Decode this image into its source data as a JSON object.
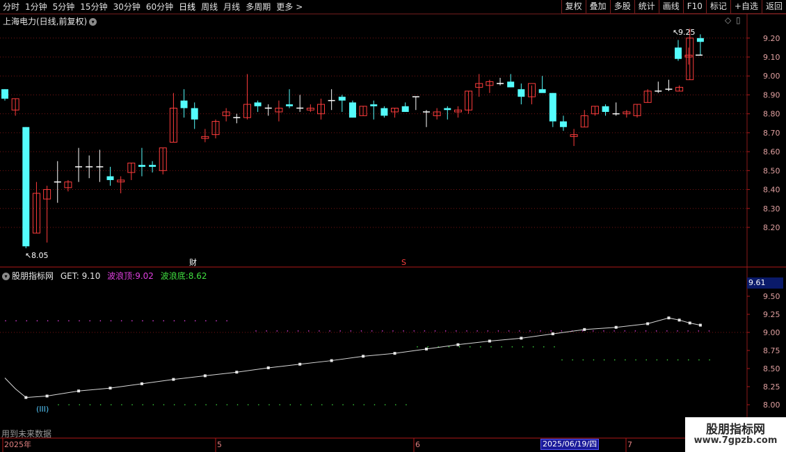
{
  "toolbar": {
    "left_items": [
      "分时",
      "1分钟",
      "5分钟",
      "15分钟",
      "30分钟",
      "60分钟",
      "日线",
      "周线",
      "月线",
      "多周期",
      "更多"
    ],
    "active": "日线",
    "more_arrow": ">",
    "right_buttons": [
      "复权",
      "叠加",
      "多股",
      "统计",
      "画线",
      "F10",
      "标记",
      "+自选",
      "返回"
    ]
  },
  "main_chart": {
    "title": "上海电力(日线,前复权)",
    "y_ticks": [
      "9.20",
      "9.10",
      "9.00",
      "8.90",
      "8.80",
      "8.70",
      "8.60",
      "8.50",
      "8.40",
      "8.30",
      "8.20"
    ],
    "high_label": "9.25",
    "low_label": "8.05",
    "marker_cai": "财",
    "marker_s": "S"
  },
  "sub_chart": {
    "title": "股朋指标网",
    "get_label": "GET:",
    "get_value": "9.10",
    "top_label": "波浪顶:",
    "top_value": "9.02",
    "bottom_label": "波浪底:",
    "bottom_value": "8.62",
    "value_box": "9.61",
    "y_ticks": [
      "9.50",
      "9.25",
      "9.00",
      "8.75",
      "8.50",
      "8.25",
      "8.00"
    ],
    "wave_label": "(III)",
    "future_note": "用到未来数据"
  },
  "time_axis": {
    "labels": [
      "2025年",
      "5",
      "6",
      "7"
    ],
    "selected_date": "2025/06/19/四"
  },
  "watermark": {
    "title": "股朋指标网",
    "url": "www.7gpzb.com"
  },
  "chart_data": {
    "type": "candlestick",
    "x": [
      1,
      2,
      3,
      4,
      5,
      6,
      7,
      8,
      9,
      10,
      11,
      12,
      13,
      14,
      15,
      16,
      17,
      18,
      19,
      20,
      21,
      22,
      23,
      24,
      25,
      26,
      27,
      28,
      29,
      30,
      31,
      32,
      33,
      34,
      35,
      36,
      37,
      38,
      39,
      40,
      41,
      42,
      43,
      44,
      45,
      46,
      47,
      48,
      49,
      50,
      51,
      52,
      53,
      54,
      55,
      56,
      57,
      58,
      59,
      60,
      61,
      62,
      63,
      64,
      65,
      66,
      67
    ],
    "ohlc": [
      [
        8.93,
        8.93,
        8.87,
        8.88
      ],
      [
        8.82,
        8.88,
        8.79,
        8.88
      ],
      [
        8.73,
        8.73,
        8.09,
        8.1
      ],
      [
        8.17,
        8.44,
        8.17,
        8.38
      ],
      [
        8.35,
        8.42,
        8.12,
        8.4
      ],
      [
        8.44,
        8.55,
        8.33,
        8.44
      ],
      [
        8.41,
        8.45,
        8.39,
        8.44
      ],
      [
        8.52,
        8.62,
        8.44,
        8.52
      ],
      [
        8.52,
        8.58,
        8.46,
        8.52
      ],
      [
        8.52,
        8.61,
        8.44,
        8.52
      ],
      [
        8.47,
        8.52,
        8.42,
        8.45
      ],
      [
        8.44,
        8.47,
        8.38,
        8.45
      ],
      [
        8.49,
        8.54,
        8.45,
        8.54
      ],
      [
        8.53,
        8.62,
        8.47,
        8.52
      ],
      [
        8.53,
        8.55,
        8.49,
        8.52
      ],
      [
        8.5,
        8.62,
        8.48,
        8.62
      ],
      [
        8.65,
        8.91,
        8.65,
        8.83
      ],
      [
        8.87,
        8.93,
        8.78,
        8.83
      ],
      [
        8.83,
        8.86,
        8.72,
        8.77
      ],
      [
        8.67,
        8.72,
        8.65,
        8.68
      ],
      [
        8.69,
        8.77,
        8.67,
        8.76
      ],
      [
        8.79,
        8.83,
        8.76,
        8.81
      ],
      [
        8.78,
        8.8,
        8.75,
        8.78
      ],
      [
        8.78,
        9.01,
        8.77,
        8.85
      ],
      [
        8.86,
        8.87,
        8.81,
        8.84
      ],
      [
        8.83,
        8.85,
        8.79,
        8.83
      ],
      [
        8.81,
        8.87,
        8.76,
        8.83
      ],
      [
        8.85,
        8.93,
        8.83,
        8.84
      ],
      [
        8.83,
        8.9,
        8.81,
        8.83
      ],
      [
        8.82,
        8.85,
        8.81,
        8.83
      ],
      [
        8.8,
        8.88,
        8.77,
        8.85
      ],
      [
        8.87,
        8.93,
        8.82,
        8.87
      ],
      [
        8.89,
        8.9,
        8.81,
        8.87
      ],
      [
        8.86,
        8.87,
        8.78,
        8.78
      ],
      [
        8.79,
        8.84,
        8.79,
        8.84
      ],
      [
        8.85,
        8.87,
        8.77,
        8.84
      ],
      [
        8.83,
        8.84,
        8.78,
        8.79
      ],
      [
        8.81,
        8.83,
        8.78,
        8.83
      ],
      [
        8.84,
        8.86,
        8.81,
        8.81
      ],
      [
        8.89,
        8.89,
        8.82,
        8.89
      ],
      [
        8.81,
        8.82,
        8.73,
        8.81
      ],
      [
        8.79,
        8.83,
        8.77,
        8.81
      ],
      [
        8.83,
        8.84,
        8.77,
        8.82
      ],
      [
        8.81,
        8.84,
        8.78,
        8.82
      ],
      [
        8.82,
        8.92,
        8.8,
        8.92
      ],
      [
        8.94,
        9.01,
        8.89,
        8.96
      ],
      [
        8.95,
        8.98,
        8.91,
        8.97
      ],
      [
        8.96,
        8.99,
        8.95,
        8.96
      ],
      [
        8.97,
        9.01,
        8.94,
        8.94
      ],
      [
        8.93,
        8.96,
        8.85,
        8.89
      ],
      [
        8.89,
        8.95,
        8.85,
        8.96
      ],
      [
        8.93,
        9.0,
        8.92,
        8.91
      ],
      [
        8.91,
        8.91,
        8.73,
        8.76
      ],
      [
        8.76,
        8.79,
        8.71,
        8.73
      ],
      [
        8.68,
        8.72,
        8.63,
        8.69
      ],
      [
        8.73,
        8.82,
        8.73,
        8.79
      ],
      [
        8.8,
        8.84,
        8.79,
        8.84
      ],
      [
        8.84,
        8.85,
        8.79,
        8.81
      ],
      [
        8.8,
        8.86,
        8.79,
        8.8
      ],
      [
        8.8,
        8.82,
        8.78,
        8.81
      ],
      [
        8.79,
        8.85,
        8.78,
        8.85
      ],
      [
        8.86,
        8.93,
        8.86,
        8.92
      ],
      [
        8.92,
        8.97,
        8.91,
        8.92
      ],
      [
        8.93,
        8.98,
        8.92,
        8.93
      ],
      [
        8.92,
        8.95,
        8.92,
        8.94
      ],
      [
        8.98,
        9.25,
        8.98,
        9.2
      ],
      [
        9.2,
        9.22,
        9.11,
        9.18
      ]
    ],
    "extra_bars_ohlc": [
      [
        9.15,
        9.19,
        9.08,
        9.09
      ],
      [
        9.1,
        9.15,
        9.06,
        9.11
      ],
      [
        9.11,
        9.11,
        9.11,
        9.11
      ]
    ],
    "ylim": [
      8.05,
      9.25
    ],
    "get_line": {
      "x": [
        1,
        2,
        3,
        5,
        8,
        11,
        14,
        17,
        20,
        23,
        26,
        29,
        32,
        35,
        38,
        41,
        44,
        47,
        50,
        53,
        56,
        59,
        62,
        64,
        65,
        66,
        67
      ],
      "y": [
        8.37,
        8.22,
        8.1,
        8.12,
        8.19,
        8.23,
        8.29,
        8.35,
        8.4,
        8.45,
        8.51,
        8.56,
        8.61,
        8.67,
        8.71,
        8.77,
        8.83,
        8.88,
        8.92,
        8.98,
        9.04,
        9.07,
        9.12,
        9.2,
        9.17,
        9.13,
        9.1
      ]
    },
    "wave_top": 9.16,
    "wave_top_late": 9.02,
    "wave_bottom": 8.62,
    "wave_bottom_early": 8.0,
    "sub_ylim": [
      7.95,
      9.61
    ]
  }
}
